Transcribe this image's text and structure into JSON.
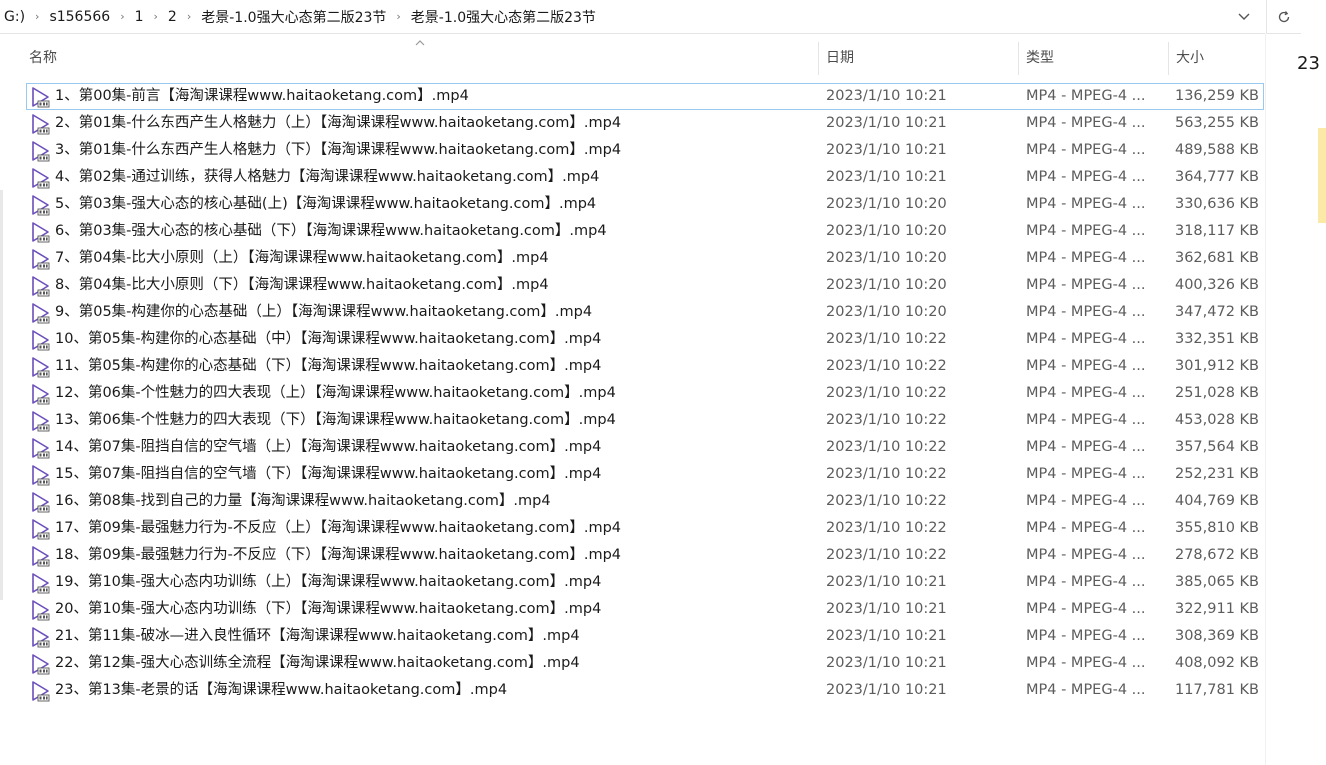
{
  "breadcrumb": [
    "G:)",
    "s156566",
    "1",
    "2",
    "老景-1.0强大心态第二版23节",
    "老景-1.0强大心态第二版23节"
  ],
  "right_panel_number": "23",
  "columns": {
    "name": "名称",
    "date": "日期",
    "type": "类型",
    "size": "大小"
  },
  "icons": {
    "separator": "chevron-right-icon",
    "dropdown": "chevron-down-icon",
    "refresh": "refresh-icon",
    "sort": "sort-ascending-icon",
    "file": "video-file-icon"
  },
  "colors": {
    "accent": "#6b4fbb",
    "focus": "#99c9ef"
  },
  "files": [
    {
      "name": "1、第00集-前言【海淘课课程www.haitaoketang.com】.mp4",
      "date": "2023/1/10 10:21",
      "type": "MP4 - MPEG-4 ...",
      "size": "136,259 KB"
    },
    {
      "name": "2、第01集-什么东西产生人格魅力（上）【海淘课课程www.haitaoketang.com】.mp4",
      "date": "2023/1/10 10:21",
      "type": "MP4 - MPEG-4 ...",
      "size": "563,255 KB"
    },
    {
      "name": "3、第01集-什么东西产生人格魅力（下）【海淘课课程www.haitaoketang.com】.mp4",
      "date": "2023/1/10 10:21",
      "type": "MP4 - MPEG-4 ...",
      "size": "489,588 KB"
    },
    {
      "name": "4、第02集-通过训练，获得人格魅力【海淘课课程www.haitaoketang.com】.mp4",
      "date": "2023/1/10 10:21",
      "type": "MP4 - MPEG-4 ...",
      "size": "364,777 KB"
    },
    {
      "name": "5、第03集-强大心态的核心基础(上)【海淘课课程www.haitaoketang.com】.mp4",
      "date": "2023/1/10 10:20",
      "type": "MP4 - MPEG-4 ...",
      "size": "330,636 KB"
    },
    {
      "name": "6、第03集-强大心态的核心基础（下）【海淘课课程www.haitaoketang.com】.mp4",
      "date": "2023/1/10 10:20",
      "type": "MP4 - MPEG-4 ...",
      "size": "318,117 KB"
    },
    {
      "name": "7、第04集-比大小原则（上）【海淘课课程www.haitaoketang.com】.mp4",
      "date": "2023/1/10 10:20",
      "type": "MP4 - MPEG-4 ...",
      "size": "362,681 KB"
    },
    {
      "name": "8、第04集-比大小原则（下）【海淘课课程www.haitaoketang.com】.mp4",
      "date": "2023/1/10 10:20",
      "type": "MP4 - MPEG-4 ...",
      "size": "400,326 KB"
    },
    {
      "name": "9、第05集-构建你的心态基础（上）【海淘课课程www.haitaoketang.com】.mp4",
      "date": "2023/1/10 10:20",
      "type": "MP4 - MPEG-4 ...",
      "size": "347,472 KB"
    },
    {
      "name": "10、第05集-构建你的心态基础（中）【海淘课课程www.haitaoketang.com】.mp4",
      "date": "2023/1/10 10:22",
      "type": "MP4 - MPEG-4 ...",
      "size": "332,351 KB"
    },
    {
      "name": "11、第05集-构建你的心态基础（下）【海淘课课程www.haitaoketang.com】.mp4",
      "date": "2023/1/10 10:22",
      "type": "MP4 - MPEG-4 ...",
      "size": "301,912 KB"
    },
    {
      "name": "12、第06集-个性魅力的四大表现（上）【海淘课课程www.haitaoketang.com】.mp4",
      "date": "2023/1/10 10:22",
      "type": "MP4 - MPEG-4 ...",
      "size": "251,028 KB"
    },
    {
      "name": "13、第06集-个性魅力的四大表现（下）【海淘课课程www.haitaoketang.com】.mp4",
      "date": "2023/1/10 10:22",
      "type": "MP4 - MPEG-4 ...",
      "size": "453,028 KB"
    },
    {
      "name": "14、第07集-阻挡自信的空气墙（上）【海淘课课程www.haitaoketang.com】.mp4",
      "date": "2023/1/10 10:22",
      "type": "MP4 - MPEG-4 ...",
      "size": "357,564 KB"
    },
    {
      "name": "15、第07集-阻挡自信的空气墙（下）【海淘课课程www.haitaoketang.com】.mp4",
      "date": "2023/1/10 10:22",
      "type": "MP4 - MPEG-4 ...",
      "size": "252,231 KB"
    },
    {
      "name": "16、第08集-找到自己的力量【海淘课课程www.haitaoketang.com】.mp4",
      "date": "2023/1/10 10:22",
      "type": "MP4 - MPEG-4 ...",
      "size": "404,769 KB"
    },
    {
      "name": "17、第09集-最强魅力行为-不反应（上）【海淘课课程www.haitaoketang.com】.mp4",
      "date": "2023/1/10 10:22",
      "type": "MP4 - MPEG-4 ...",
      "size": "355,810 KB"
    },
    {
      "name": "18、第09集-最强魅力行为-不反应（下）【海淘课课程www.haitaoketang.com】.mp4",
      "date": "2023/1/10 10:22",
      "type": "MP4 - MPEG-4 ...",
      "size": "278,672 KB"
    },
    {
      "name": "19、第10集-强大心态内功训练（上）【海淘课课程www.haitaoketang.com】.mp4",
      "date": "2023/1/10 10:21",
      "type": "MP4 - MPEG-4 ...",
      "size": "385,065 KB"
    },
    {
      "name": "20、第10集-强大心态内功训练（下）【海淘课课程www.haitaoketang.com】.mp4",
      "date": "2023/1/10 10:21",
      "type": "MP4 - MPEG-4 ...",
      "size": "322,911 KB"
    },
    {
      "name": "21、第11集-破冰—进入良性循环【海淘课课程www.haitaoketang.com】.mp4",
      "date": "2023/1/10 10:21",
      "type": "MP4 - MPEG-4 ...",
      "size": "308,369 KB"
    },
    {
      "name": "22、第12集-强大心态训练全流程【海淘课课程www.haitaoketang.com】.mp4",
      "date": "2023/1/10 10:21",
      "type": "MP4 - MPEG-4 ...",
      "size": "408,092 KB"
    },
    {
      "name": "23、第13集-老景的话【海淘课课程www.haitaoketang.com】.mp4",
      "date": "2023/1/10 10:21",
      "type": "MP4 - MPEG-4 ...",
      "size": "117,781 KB"
    }
  ]
}
